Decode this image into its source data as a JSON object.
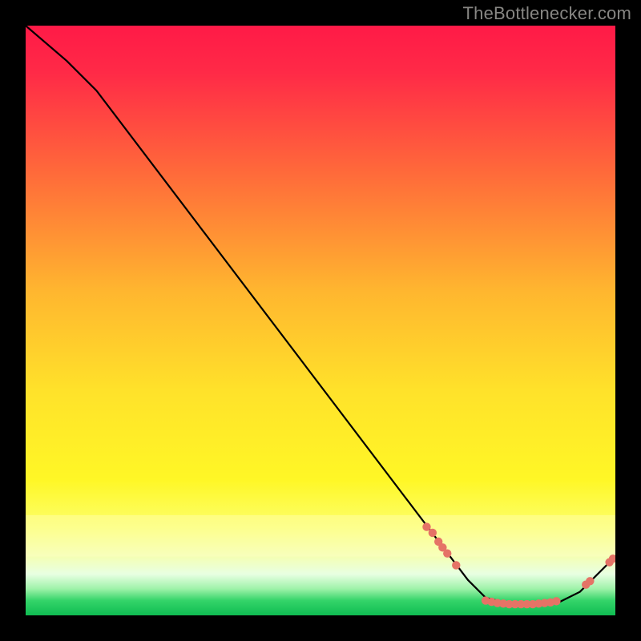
{
  "attribution": "TheBottlenecker.com",
  "colors": {
    "frame_bg": "#000000",
    "line": "#000000",
    "marker": "#e57366",
    "top_grad": "#ff1a47",
    "mid_grad": "#ffdf2a",
    "green": "#1fd160",
    "white": "#ffffff",
    "attr_text": "#878683"
  },
  "chart_data": {
    "type": "line",
    "title": "",
    "xlabel": "",
    "ylabel": "",
    "xlim": [
      0,
      100
    ],
    "ylim": [
      0,
      100
    ],
    "line_points": [
      {
        "x": 0,
        "y": 100
      },
      {
        "x": 7,
        "y": 94
      },
      {
        "x": 12,
        "y": 89
      },
      {
        "x": 75,
        "y": 6
      },
      {
        "x": 78,
        "y": 3
      },
      {
        "x": 82,
        "y": 2
      },
      {
        "x": 90,
        "y": 2
      },
      {
        "x": 94,
        "y": 4
      },
      {
        "x": 100,
        "y": 10
      }
    ],
    "markers": [
      {
        "x": 68,
        "y": 15
      },
      {
        "x": 69,
        "y": 14
      },
      {
        "x": 70,
        "y": 12.5
      },
      {
        "x": 70.7,
        "y": 11.5
      },
      {
        "x": 71.5,
        "y": 10.5
      },
      {
        "x": 73,
        "y": 8.5
      },
      {
        "x": 78,
        "y": 2.5
      },
      {
        "x": 79,
        "y": 2.3
      },
      {
        "x": 80,
        "y": 2.1
      },
      {
        "x": 81,
        "y": 2.0
      },
      {
        "x": 82,
        "y": 1.9
      },
      {
        "x": 83,
        "y": 1.9
      },
      {
        "x": 84,
        "y": 1.9
      },
      {
        "x": 85,
        "y": 1.9
      },
      {
        "x": 86,
        "y": 1.9
      },
      {
        "x": 87,
        "y": 2.0
      },
      {
        "x": 88,
        "y": 2.1
      },
      {
        "x": 89,
        "y": 2.2
      },
      {
        "x": 90,
        "y": 2.4
      },
      {
        "x": 95,
        "y": 5.2
      },
      {
        "x": 95.7,
        "y": 5.8
      },
      {
        "x": 99,
        "y": 9
      },
      {
        "x": 99.6,
        "y": 9.6
      }
    ]
  }
}
